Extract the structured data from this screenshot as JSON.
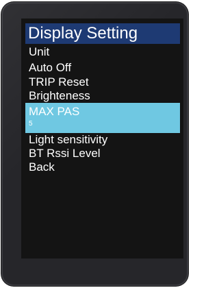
{
  "screen": {
    "title": "Display Setting",
    "menu": [
      {
        "label": "Unit"
      },
      {
        "label": "Auto Off"
      },
      {
        "label": "TRIP Reset"
      },
      {
        "label": "Brighteness"
      },
      {
        "label": "MAX PAS",
        "value": "5",
        "selected": true
      },
      {
        "label": "Light sensitivity"
      },
      {
        "label": "BT Rssi Level"
      },
      {
        "label": "Back"
      }
    ]
  },
  "colors": {
    "title_bg": "#1e3a73",
    "selected_bg": "#6fc8e2",
    "screen_bg": "#141414",
    "bezel": "#26262a",
    "text": "#ffffff"
  }
}
